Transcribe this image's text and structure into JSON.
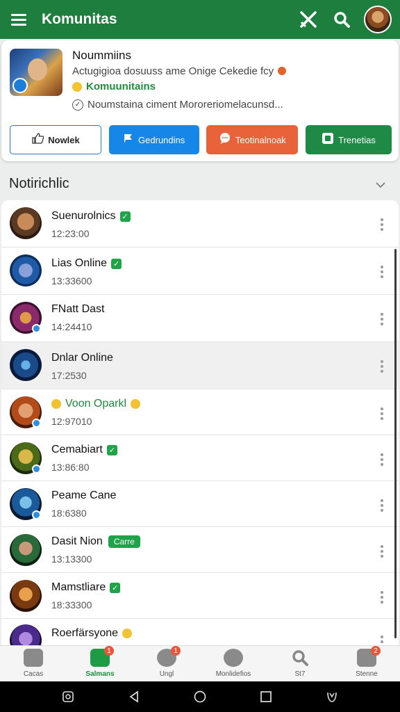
{
  "header": {
    "title": "Komunitas"
  },
  "group": {
    "name": "Noummiins",
    "description": "Actugigioa dosuuss ame Onige Cekedie fcy",
    "tag": "Komuunitains",
    "note": "Noumstaina ciment Mororeriomelacunsd...",
    "actions": [
      {
        "label": "Nowlek"
      },
      {
        "label": "Gedrundins"
      },
      {
        "label": "Teotinalnoak"
      },
      {
        "label": "Trenetias"
      }
    ]
  },
  "section": {
    "title": "Notirichlic"
  },
  "list": [
    {
      "name": "Suenurolnics",
      "time": "12:23:00",
      "badge": "verified"
    },
    {
      "name": "Lias Online",
      "time": "13:33600",
      "badge": "verified"
    },
    {
      "name": "FNatt Dast",
      "time": "14:24410",
      "badge": ""
    },
    {
      "name": "Dnlar Online",
      "time": "17:2530",
      "badge": ""
    },
    {
      "name": "Voon Oparkl",
      "time": "12:97010",
      "badge": "emoji"
    },
    {
      "name": "Cemabiart",
      "time": "13:86:80",
      "badge": "verified"
    },
    {
      "name": "Peame Cane",
      "time": "18:6380",
      "badge": ""
    },
    {
      "name": "Dasit Nion",
      "time": "13:13300",
      "badge": "pill",
      "pill": "Carre"
    },
    {
      "name": "Mamstliare",
      "time": "18:33300",
      "badge": "verified"
    },
    {
      "name": "Roerfärsyone",
      "time": "",
      "badge": "emoji"
    }
  ],
  "bottom_nav": [
    {
      "label": "Cacas",
      "badge": ""
    },
    {
      "label": "Salmans",
      "badge": "1"
    },
    {
      "label": "Ungl",
      "badge": "1"
    },
    {
      "label": "Monlidefios",
      "badge": ""
    },
    {
      "label": "St7",
      "badge": ""
    },
    {
      "label": "Stenne",
      "badge": "2"
    }
  ],
  "colors": {
    "primary": "#1e7e3e",
    "accent_blue": "#1687e8",
    "accent_orange": "#e8623a",
    "accent_green": "#1f8a45"
  }
}
